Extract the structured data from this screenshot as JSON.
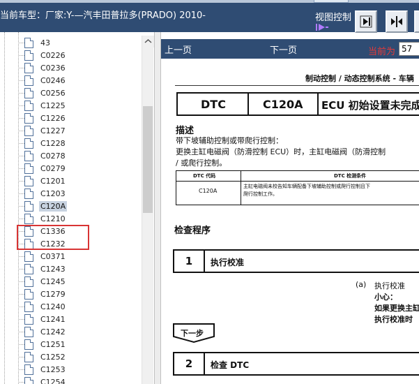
{
  "header": {
    "title": "当前车型：厂家:Y-—汽丰田普拉多(PRADO) 2010-",
    "view_control_label": "视图控制"
  },
  "tree": {
    "items": [
      {
        "label": "43",
        "selected": false
      },
      {
        "label": "C0226",
        "selected": false
      },
      {
        "label": "C0236",
        "selected": false
      },
      {
        "label": "C0246",
        "selected": false
      },
      {
        "label": "C0256",
        "selected": false
      },
      {
        "label": "C1225",
        "selected": false
      },
      {
        "label": "C1226",
        "selected": false
      },
      {
        "label": "C1227",
        "selected": false
      },
      {
        "label": "C1228",
        "selected": false
      },
      {
        "label": "C0278",
        "selected": false
      },
      {
        "label": "C0279",
        "selected": false
      },
      {
        "label": "C1201",
        "selected": false
      },
      {
        "label": "C1203",
        "selected": false
      },
      {
        "label": "C120A",
        "selected": true
      },
      {
        "label": "C1210",
        "selected": false
      },
      {
        "label": "C1336",
        "selected": false
      },
      {
        "label": "C1232",
        "selected": false
      },
      {
        "label": "C0371",
        "selected": false
      },
      {
        "label": "C1243",
        "selected": false
      },
      {
        "label": "C1245",
        "selected": false
      },
      {
        "label": "C1279",
        "selected": false
      },
      {
        "label": "C1240",
        "selected": false
      },
      {
        "label": "C1241",
        "selected": false
      },
      {
        "label": "C1242",
        "selected": false
      },
      {
        "label": "C1251",
        "selected": false
      },
      {
        "label": "C1252",
        "selected": false
      },
      {
        "label": "C1253",
        "selected": false
      },
      {
        "label": "C1254",
        "selected": false
      }
    ]
  },
  "nav": {
    "prev_label": "上一页",
    "next_label": "下一页",
    "current_label": "当前为",
    "page_value": "57"
  },
  "document": {
    "header": "制动控制 / 动态控制系统 - 车辆",
    "dtc_label": "DTC",
    "dtc_code": "C120A",
    "dtc_title": "ECU 初始设置未完成",
    "desc_heading": "描述",
    "desc_line1": "带下坡辅助控制或带爬行控制：",
    "desc_line2": "更换主缸电磁阀（防滑控制 ECU）时，主缸电磁阀（防滑控制",
    "desc_line3": "/ 或爬行控制。",
    "table_header_code": "DTC 代码",
    "table_header_cond": "DTC 检测条件",
    "table_code": "C120A",
    "table_cond_line1": "主缸电磁阀未校告知车辆配备下坡辅助控制或爬行控制且下",
    "table_cond_line2": "爬行控制工作。",
    "check_heading": "检查程序",
    "step1_num": "1",
    "step1_text": "执行校准",
    "sub_a_label": "(a)",
    "sub_a_text": "执行校准",
    "sub_caution": "小心：",
    "sub_caution_line1": "如果更换主缸",
    "sub_caution_line2": "执行校准时",
    "next_step_label": "下一步",
    "step2_num": "2",
    "step2_text": "检查 DTC"
  },
  "colors": {
    "title_bar": "#2f4c73",
    "highlight_box": "#d83434",
    "current_label": "#e33a3a"
  }
}
